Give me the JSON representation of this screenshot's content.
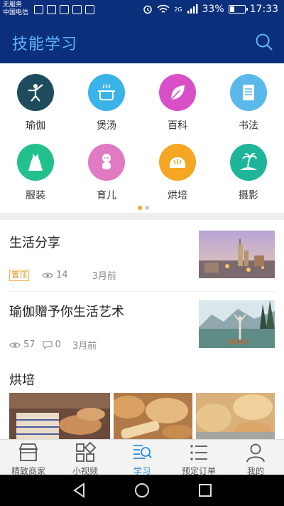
{
  "status_bar": {
    "carrier_line1": "无服务",
    "carrier_line2": "中国电信",
    "network": "2G",
    "battery": "33%",
    "battery_fraction": 0.33,
    "time": "17:33"
  },
  "header": {
    "title": "技能学习"
  },
  "categories": [
    {
      "label": "瑜伽",
      "icon": "yoga-icon",
      "color": "#1e4b5e"
    },
    {
      "label": "煲汤",
      "icon": "soup-pot-icon",
      "color": "#3ab3e8"
    },
    {
      "label": "百科",
      "icon": "leaf-icon",
      "color": "#d94fc8"
    },
    {
      "label": "书法",
      "icon": "document-icon",
      "color": "#5ab9ea"
    },
    {
      "label": "服装",
      "icon": "dress-icon",
      "color": "#22c08c"
    },
    {
      "label": "育儿",
      "icon": "baby-icon",
      "color": "#e07ac3"
    },
    {
      "label": "烘培",
      "icon": "bun-icon",
      "color": "#f5a623"
    },
    {
      "label": "摄影",
      "icon": "palm-island-icon",
      "color": "#1fb59a"
    }
  ],
  "articles": [
    {
      "title": "生活分享",
      "badge": "置顶",
      "views": "14",
      "date": "3月前"
    },
    {
      "title": "瑜伽赠予你生活艺术",
      "views": "57",
      "comments": "0",
      "date": "3月前"
    }
  ],
  "section": {
    "title": "烘培"
  },
  "tabs": [
    {
      "label": "精致商家",
      "icon": "shop-icon"
    },
    {
      "label": "小视频",
      "icon": "grid-icon"
    },
    {
      "label": "学习",
      "icon": "learn-search-icon"
    },
    {
      "label": "预定订单",
      "icon": "list-icon"
    },
    {
      "label": "我的",
      "icon": "person-icon"
    }
  ],
  "colors": {
    "header_bg": "#0b2f7a",
    "title": "#5fb4ff",
    "tab_active": "#2a8cd9",
    "badge": "#e09a26"
  }
}
